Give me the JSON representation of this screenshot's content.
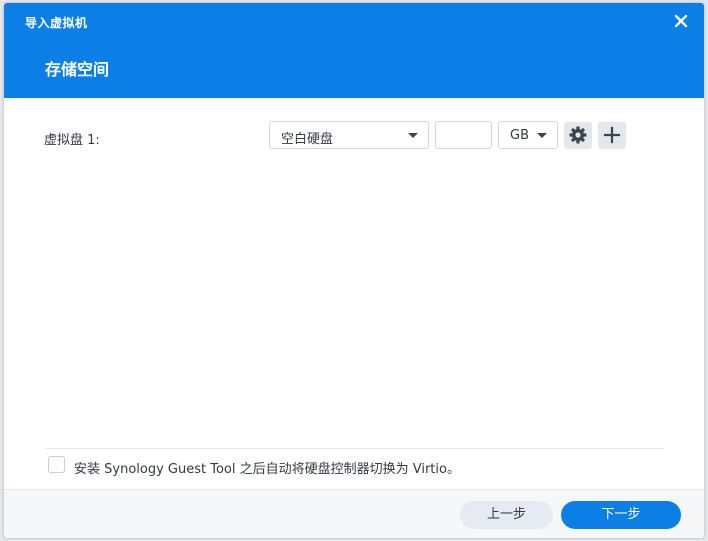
{
  "window": {
    "title": "导入虚拟机",
    "close_icon": "close-icon"
  },
  "header": {
    "section_title": "存储空间",
    "background_color": "#0b7fe6"
  },
  "disk": {
    "label": "虚拟盘 1:",
    "type_value": "空白硬盘",
    "size_value": "",
    "unit_value": "GB",
    "settings_icon": "gear-icon",
    "add_icon": "plus-icon"
  },
  "option": {
    "checked": false,
    "label": "安装 Synology Guest Tool 之后自动将硬盘控制器切换为 Virtio。"
  },
  "footer": {
    "prev_label": "上一步",
    "next_label": "下一步"
  }
}
